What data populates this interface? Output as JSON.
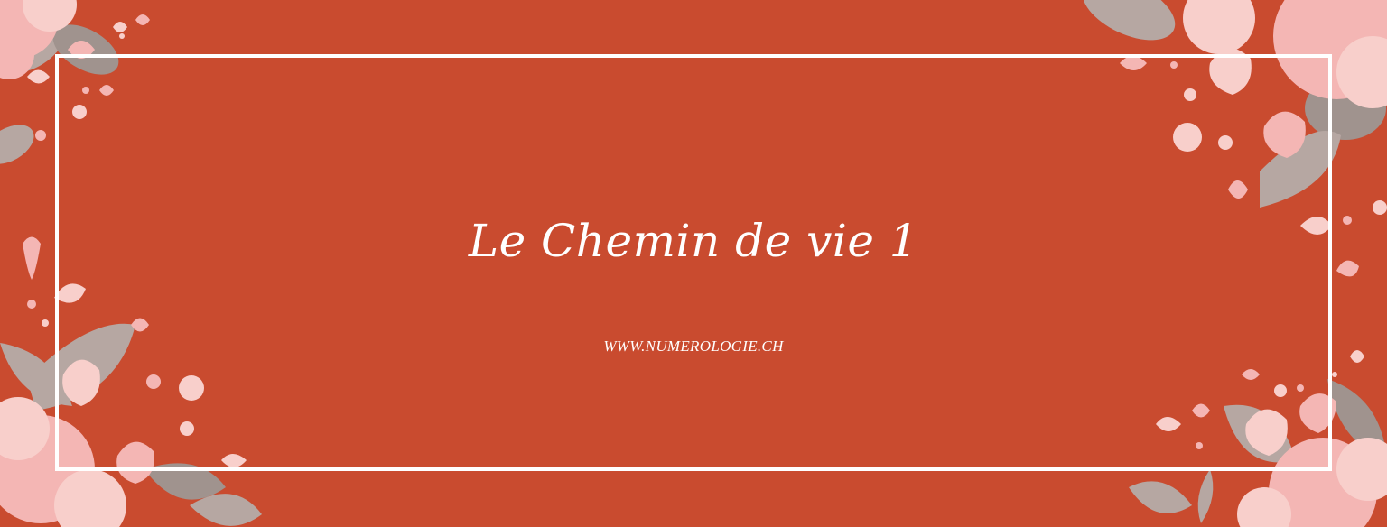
{
  "banner": {
    "title": "Le Chemin de vie 1",
    "website": "WWW.NUMEROLOGIE.CH"
  },
  "colors": {
    "background": "#c94b2f",
    "frame": "#ffffff",
    "petal_pink": "#f4b6b4",
    "petal_light": "#f8cfcb",
    "leaf_gray": "#b6a7a2",
    "leaf_dark": "#a0938e"
  },
  "decorations": {
    "top_left": "floral-corner-icon",
    "bottom_left": "floral-corner-icon",
    "top_right": "floral-corner-icon",
    "bottom_right": "floral-corner-icon"
  }
}
